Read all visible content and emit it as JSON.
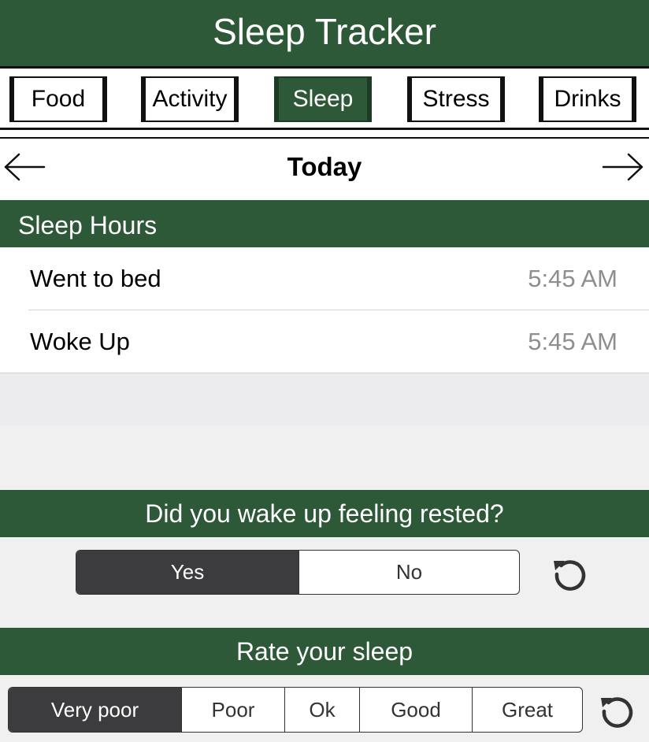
{
  "app": {
    "title": "Sleep Tracker"
  },
  "tabs": [
    {
      "label": "Food",
      "active": false
    },
    {
      "label": "Activity",
      "active": false
    },
    {
      "label": "Sleep",
      "active": true
    },
    {
      "label": "Stress",
      "active": false
    },
    {
      "label": "Drinks",
      "active": false
    }
  ],
  "date_nav": {
    "label": "Today",
    "prev_icon": "arrow-left-icon",
    "next_icon": "arrow-right-icon"
  },
  "sleep_hours": {
    "header": "Sleep Hours",
    "rows": [
      {
        "label": "Went to bed",
        "value": "5:45 AM"
      },
      {
        "label": "Woke Up",
        "value": "5:45 AM"
      }
    ]
  },
  "rested": {
    "question": "Did you wake up feeling rested?",
    "options": [
      "Yes",
      "No"
    ],
    "selected": "Yes",
    "reset_icon": "reset-icon"
  },
  "rating": {
    "question": "Rate your sleep",
    "options": [
      "Very poor",
      "Poor",
      "Ok",
      "Good",
      "Great"
    ],
    "selected": "Very poor",
    "reset_icon": "reset-icon"
  },
  "colors": {
    "accent": "#2e5939",
    "selected_segment": "#3c3c3e",
    "secondary_text": "#8e8e8e"
  }
}
